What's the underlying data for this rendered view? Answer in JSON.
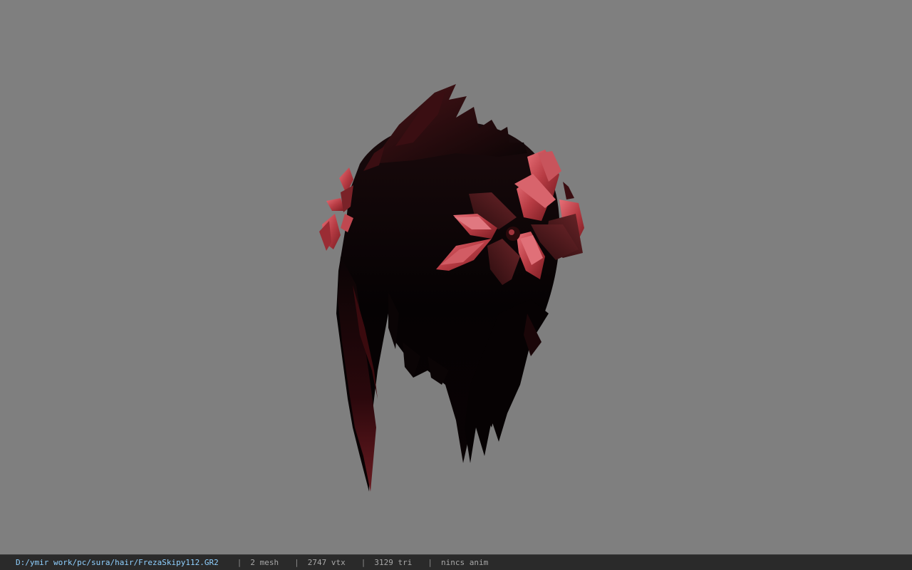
{
  "viewer": {
    "background_color": "#7f7f7f",
    "model_name": "FrezaSkipy112.GR2",
    "model_description": "3D hair model with red flower ornaments"
  },
  "status": {
    "file_path": "D:/ymir work/pc/sura/hair/FrezaSkipy112.GR2",
    "separator": "|",
    "mesh": "2 mesh",
    "vertices": "2747 vtx",
    "triangles": "3129 tri",
    "anim": "nincs anim"
  },
  "colors": {
    "hair": "#0a0506",
    "hair_tip": "#5a0f14",
    "petal_light": "#d85a62",
    "petal_mid": "#a8343c",
    "petal_dark": "#5a1a1e",
    "status_bg": "#2a2a2a",
    "status_path": "#8fd0ff",
    "status_text": "#a8a8a8"
  }
}
